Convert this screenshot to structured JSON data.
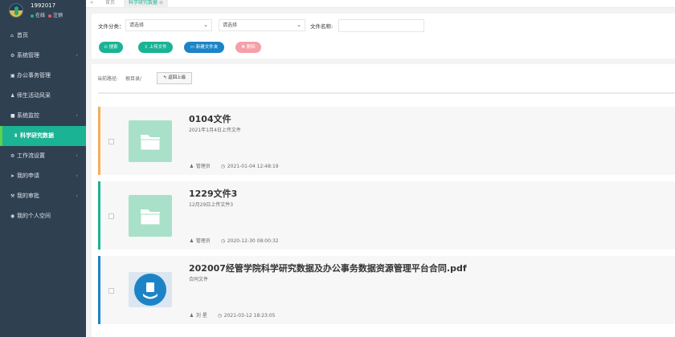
{
  "user": {
    "name": "1992017",
    "status_online": "在线",
    "logout": "注销"
  },
  "tabs": {
    "nav": "«",
    "home": "首页",
    "active": "科学研究数据",
    "close": "⊗"
  },
  "menu": [
    {
      "icon": "home-icon",
      "glyph": "⌂",
      "label": "首页",
      "arrow": ""
    },
    {
      "icon": "gear-icon",
      "glyph": "⚙",
      "label": "系统管理",
      "arrow": "‹"
    },
    {
      "icon": "briefcase-icon",
      "glyph": "▣",
      "label": "办公事务管理",
      "arrow": ""
    },
    {
      "icon": "users-icon",
      "glyph": "♟",
      "label": "师生活动风采",
      "arrow": ""
    },
    {
      "icon": "video-icon",
      "glyph": "■",
      "label": "系统监控",
      "arrow": "‹"
    },
    {
      "icon": "graduation-icon",
      "glyph": "♜",
      "label": "科学研究数据",
      "arrow": ""
    },
    {
      "icon": "cogs-icon",
      "glyph": "⚙",
      "label": "工作流设置",
      "arrow": "‹"
    },
    {
      "icon": "send-icon",
      "glyph": "➤",
      "label": "我的申请",
      "arrow": "‹"
    },
    {
      "icon": "gavel-icon",
      "glyph": "⚒",
      "label": "我的审批",
      "arrow": "‹"
    },
    {
      "icon": "user-circle-icon",
      "glyph": "◉",
      "label": "我的个人空间",
      "arrow": ""
    }
  ],
  "search": {
    "category_label": "文件分类：",
    "category_value": "请选择",
    "subcategory_value": "请选择",
    "name_label": "文件名称:",
    "name_value": "",
    "search_btn": "⊙ 搜索",
    "upload_btn": "⇪ 上传文件",
    "newfolder_btn": "▭ 新建文件夹",
    "delete_btn": "✖ 删除"
  },
  "path": {
    "label": "当前路径:",
    "value": "根目录/",
    "back": "↰ 返回上级"
  },
  "files": [
    {
      "title": "0104文件",
      "desc": "2021年1月4日上传文件",
      "uploader": "管理员",
      "time": "2021-01-04 12:48:19",
      "type": "folder"
    },
    {
      "title": "1229文件3",
      "desc": "12月29日上传文件3",
      "uploader": "管理员",
      "time": "2020-12-30 08:00:32",
      "type": "folder"
    },
    {
      "title": "202007经管学院科学研究数据及办公事务数据资源管理平台合同.pdf",
      "desc": "合同文件",
      "uploader": "刘 星",
      "time": "2021-03-12 18:23:05",
      "type": "file"
    }
  ],
  "colors": {
    "sidebar": "#2f4050",
    "accent": "#1ab394",
    "blue": "#1c84c6",
    "orange": "#f8ac59"
  }
}
